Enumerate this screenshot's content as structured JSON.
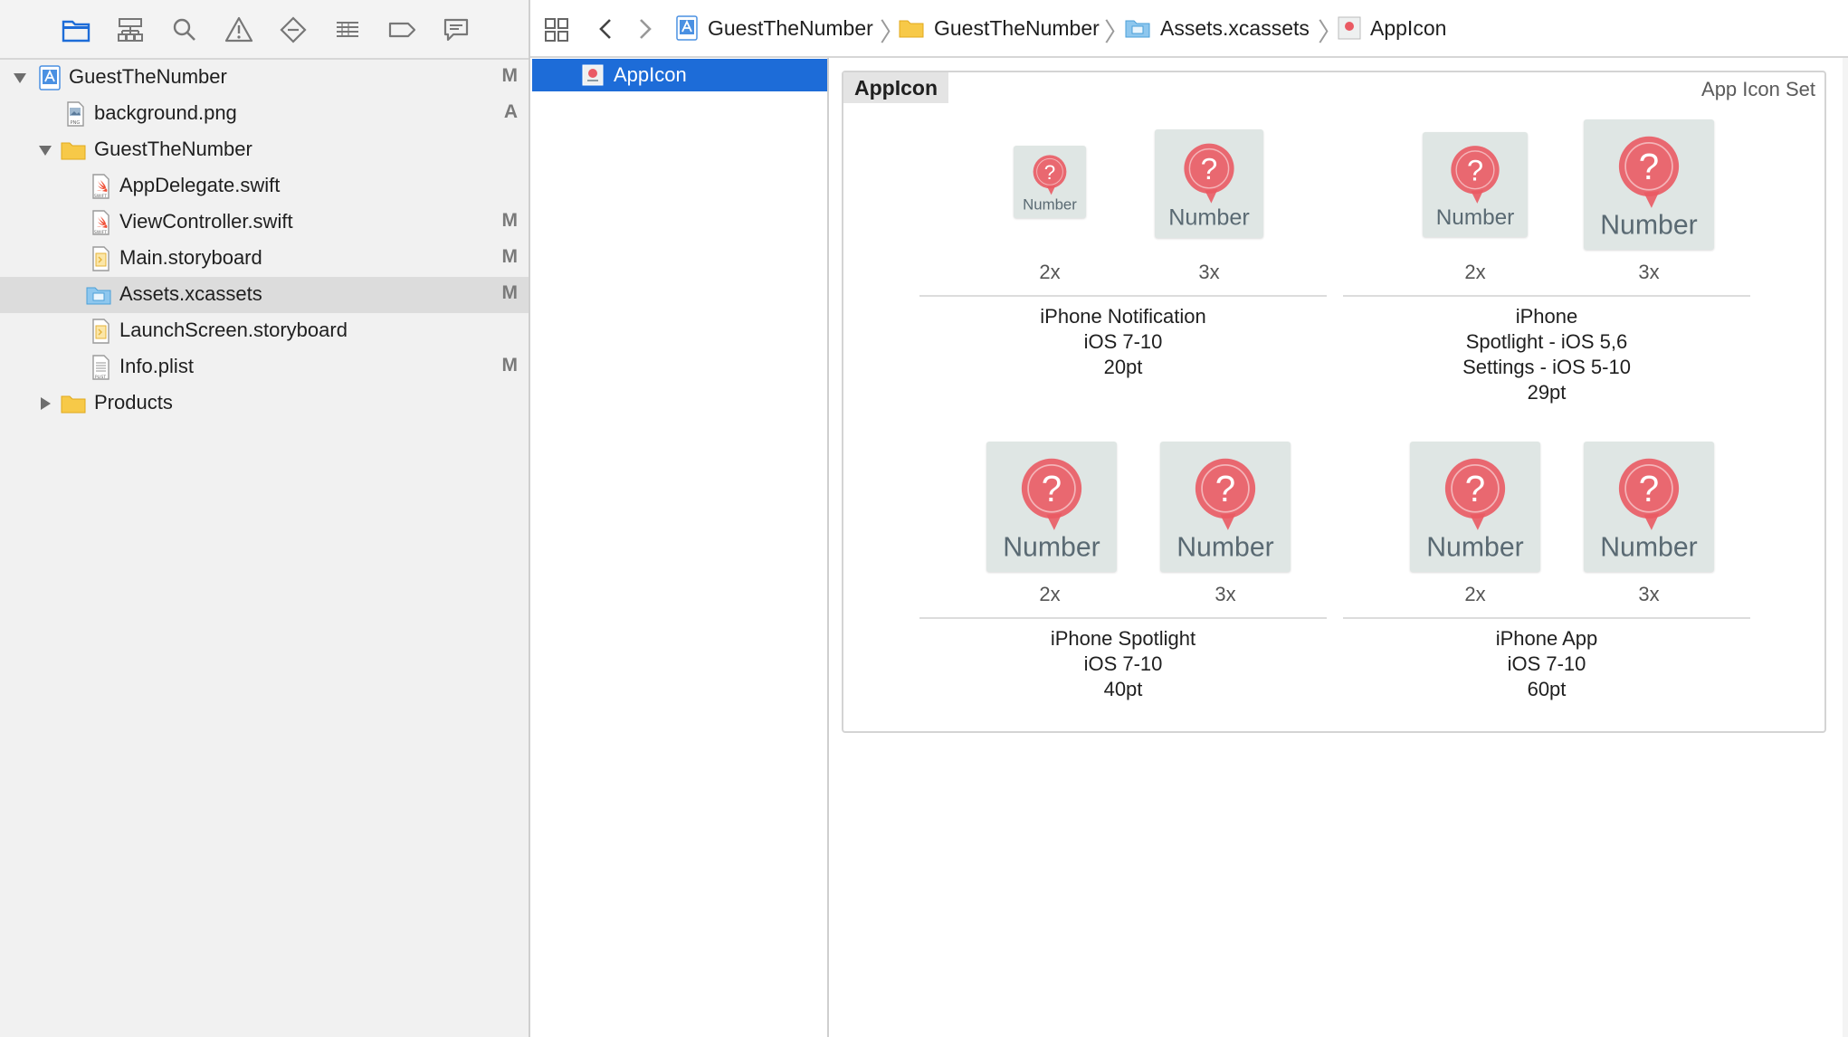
{
  "navigator": {
    "toolbar": [
      "folder-icon",
      "hierarchy-icon",
      "search-icon",
      "warning-icon",
      "test-diamond-icon",
      "debug-list-icon",
      "breakpoint-icon",
      "report-icon"
    ],
    "items": [
      {
        "label": "GuestTheNumber",
        "status": "M",
        "icon": "project-icon",
        "indent": 0,
        "disclosure": "open"
      },
      {
        "label": "background.png",
        "status": "A",
        "icon": "png-file-icon",
        "indent": 1,
        "disclosure": "none"
      },
      {
        "label": "GuestTheNumber",
        "status": "",
        "icon": "folder-icon",
        "indent": 1,
        "disclosure": "open"
      },
      {
        "label": "AppDelegate.swift",
        "status": "",
        "icon": "swift-file-icon",
        "indent": 2,
        "disclosure": "none"
      },
      {
        "label": "ViewController.swift",
        "status": "M",
        "icon": "swift-file-icon",
        "indent": 2,
        "disclosure": "none"
      },
      {
        "label": "Main.storyboard",
        "status": "M",
        "icon": "storyboard-icon",
        "indent": 2,
        "disclosure": "none"
      },
      {
        "label": "Assets.xcassets",
        "status": "M",
        "icon": "xcassets-folder-icon",
        "indent": 2,
        "disclosure": "none",
        "selected": true
      },
      {
        "label": "LaunchScreen.storyboard",
        "status": "",
        "icon": "storyboard-icon",
        "indent": 2,
        "disclosure": "none"
      },
      {
        "label": "Info.plist",
        "status": "M",
        "icon": "plist-file-icon",
        "indent": 2,
        "disclosure": "none"
      },
      {
        "label": "Products",
        "status": "",
        "icon": "folder-icon",
        "indent": 1,
        "disclosure": "closed"
      }
    ]
  },
  "jumpbar": {
    "crumbs": [
      {
        "label": "GuestTheNumber",
        "icon": "project-icon"
      },
      {
        "label": "GuestTheNumber",
        "icon": "folder-icon"
      },
      {
        "label": "Assets.xcassets",
        "icon": "xcassets-folder-icon"
      },
      {
        "label": "AppIcon",
        "icon": "appicon-icon"
      }
    ]
  },
  "assetlist": {
    "selected_label": "AppIcon"
  },
  "detail": {
    "set_name": "AppIcon",
    "set_type": "App Icon Set",
    "icon_text": "Number",
    "icon_symbol": "?",
    "colors": {
      "accent": "#1d6cd8",
      "bubble": "#ea5a63",
      "tile": "#dfe6e4",
      "icon_text": "#5a6a73"
    },
    "groups": [
      {
        "caption": [
          "iPhone Notification",
          "iOS 7-10",
          "20pt"
        ],
        "slots": [
          "2x",
          "3x"
        ]
      },
      {
        "caption": [
          "iPhone",
          "Spotlight - iOS 5,6",
          "Settings - iOS 5-10",
          "29pt"
        ],
        "slots": [
          "2x",
          "3x"
        ]
      },
      {
        "caption": [
          "iPhone Spotlight",
          "iOS 7-10",
          "40pt"
        ],
        "slots": [
          "2x",
          "3x"
        ]
      },
      {
        "caption": [
          "iPhone App",
          "iOS 7-10",
          "60pt"
        ],
        "slots": [
          "2x",
          "3x"
        ]
      }
    ]
  }
}
